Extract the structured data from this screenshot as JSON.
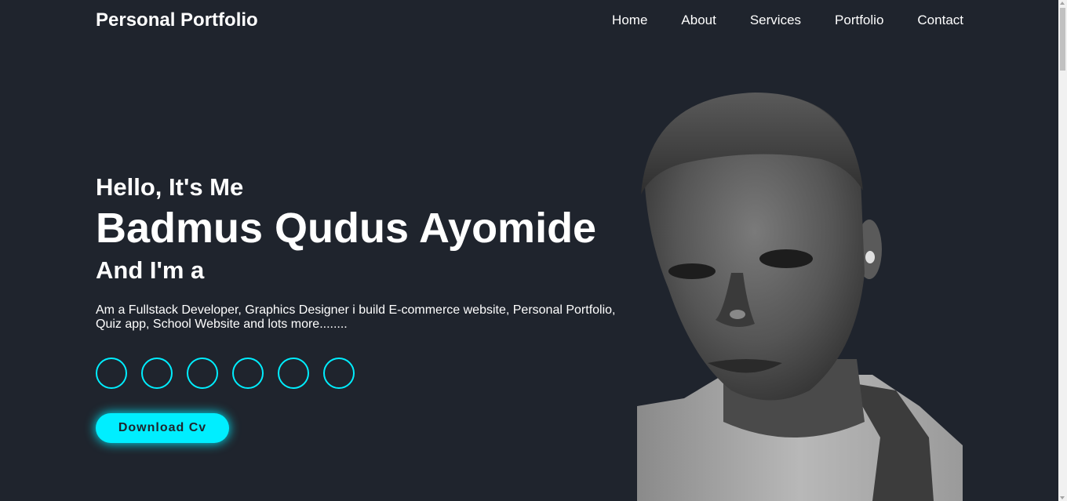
{
  "header": {
    "logo": "Personal Portfolio",
    "nav": [
      "Home",
      "About",
      "Services",
      "Portfolio",
      "Contact"
    ]
  },
  "hero": {
    "greeting": "Hello, It's Me",
    "name": "Badmus Qudus Ayomide",
    "role": "And I'm a",
    "description": "Am a Fullstack Developer, Graphics Designer i build E-commerce website, Personal Portfolio, Quiz app, School Website and lots more........",
    "social_icons": [
      "social-icon-1",
      "social-icon-2",
      "social-icon-3",
      "social-icon-4",
      "social-icon-5",
      "social-icon-6"
    ],
    "cv_button": "Download Cv"
  },
  "colors": {
    "background": "#1f242d",
    "accent": "#00eeff",
    "text": "#ffffff"
  }
}
